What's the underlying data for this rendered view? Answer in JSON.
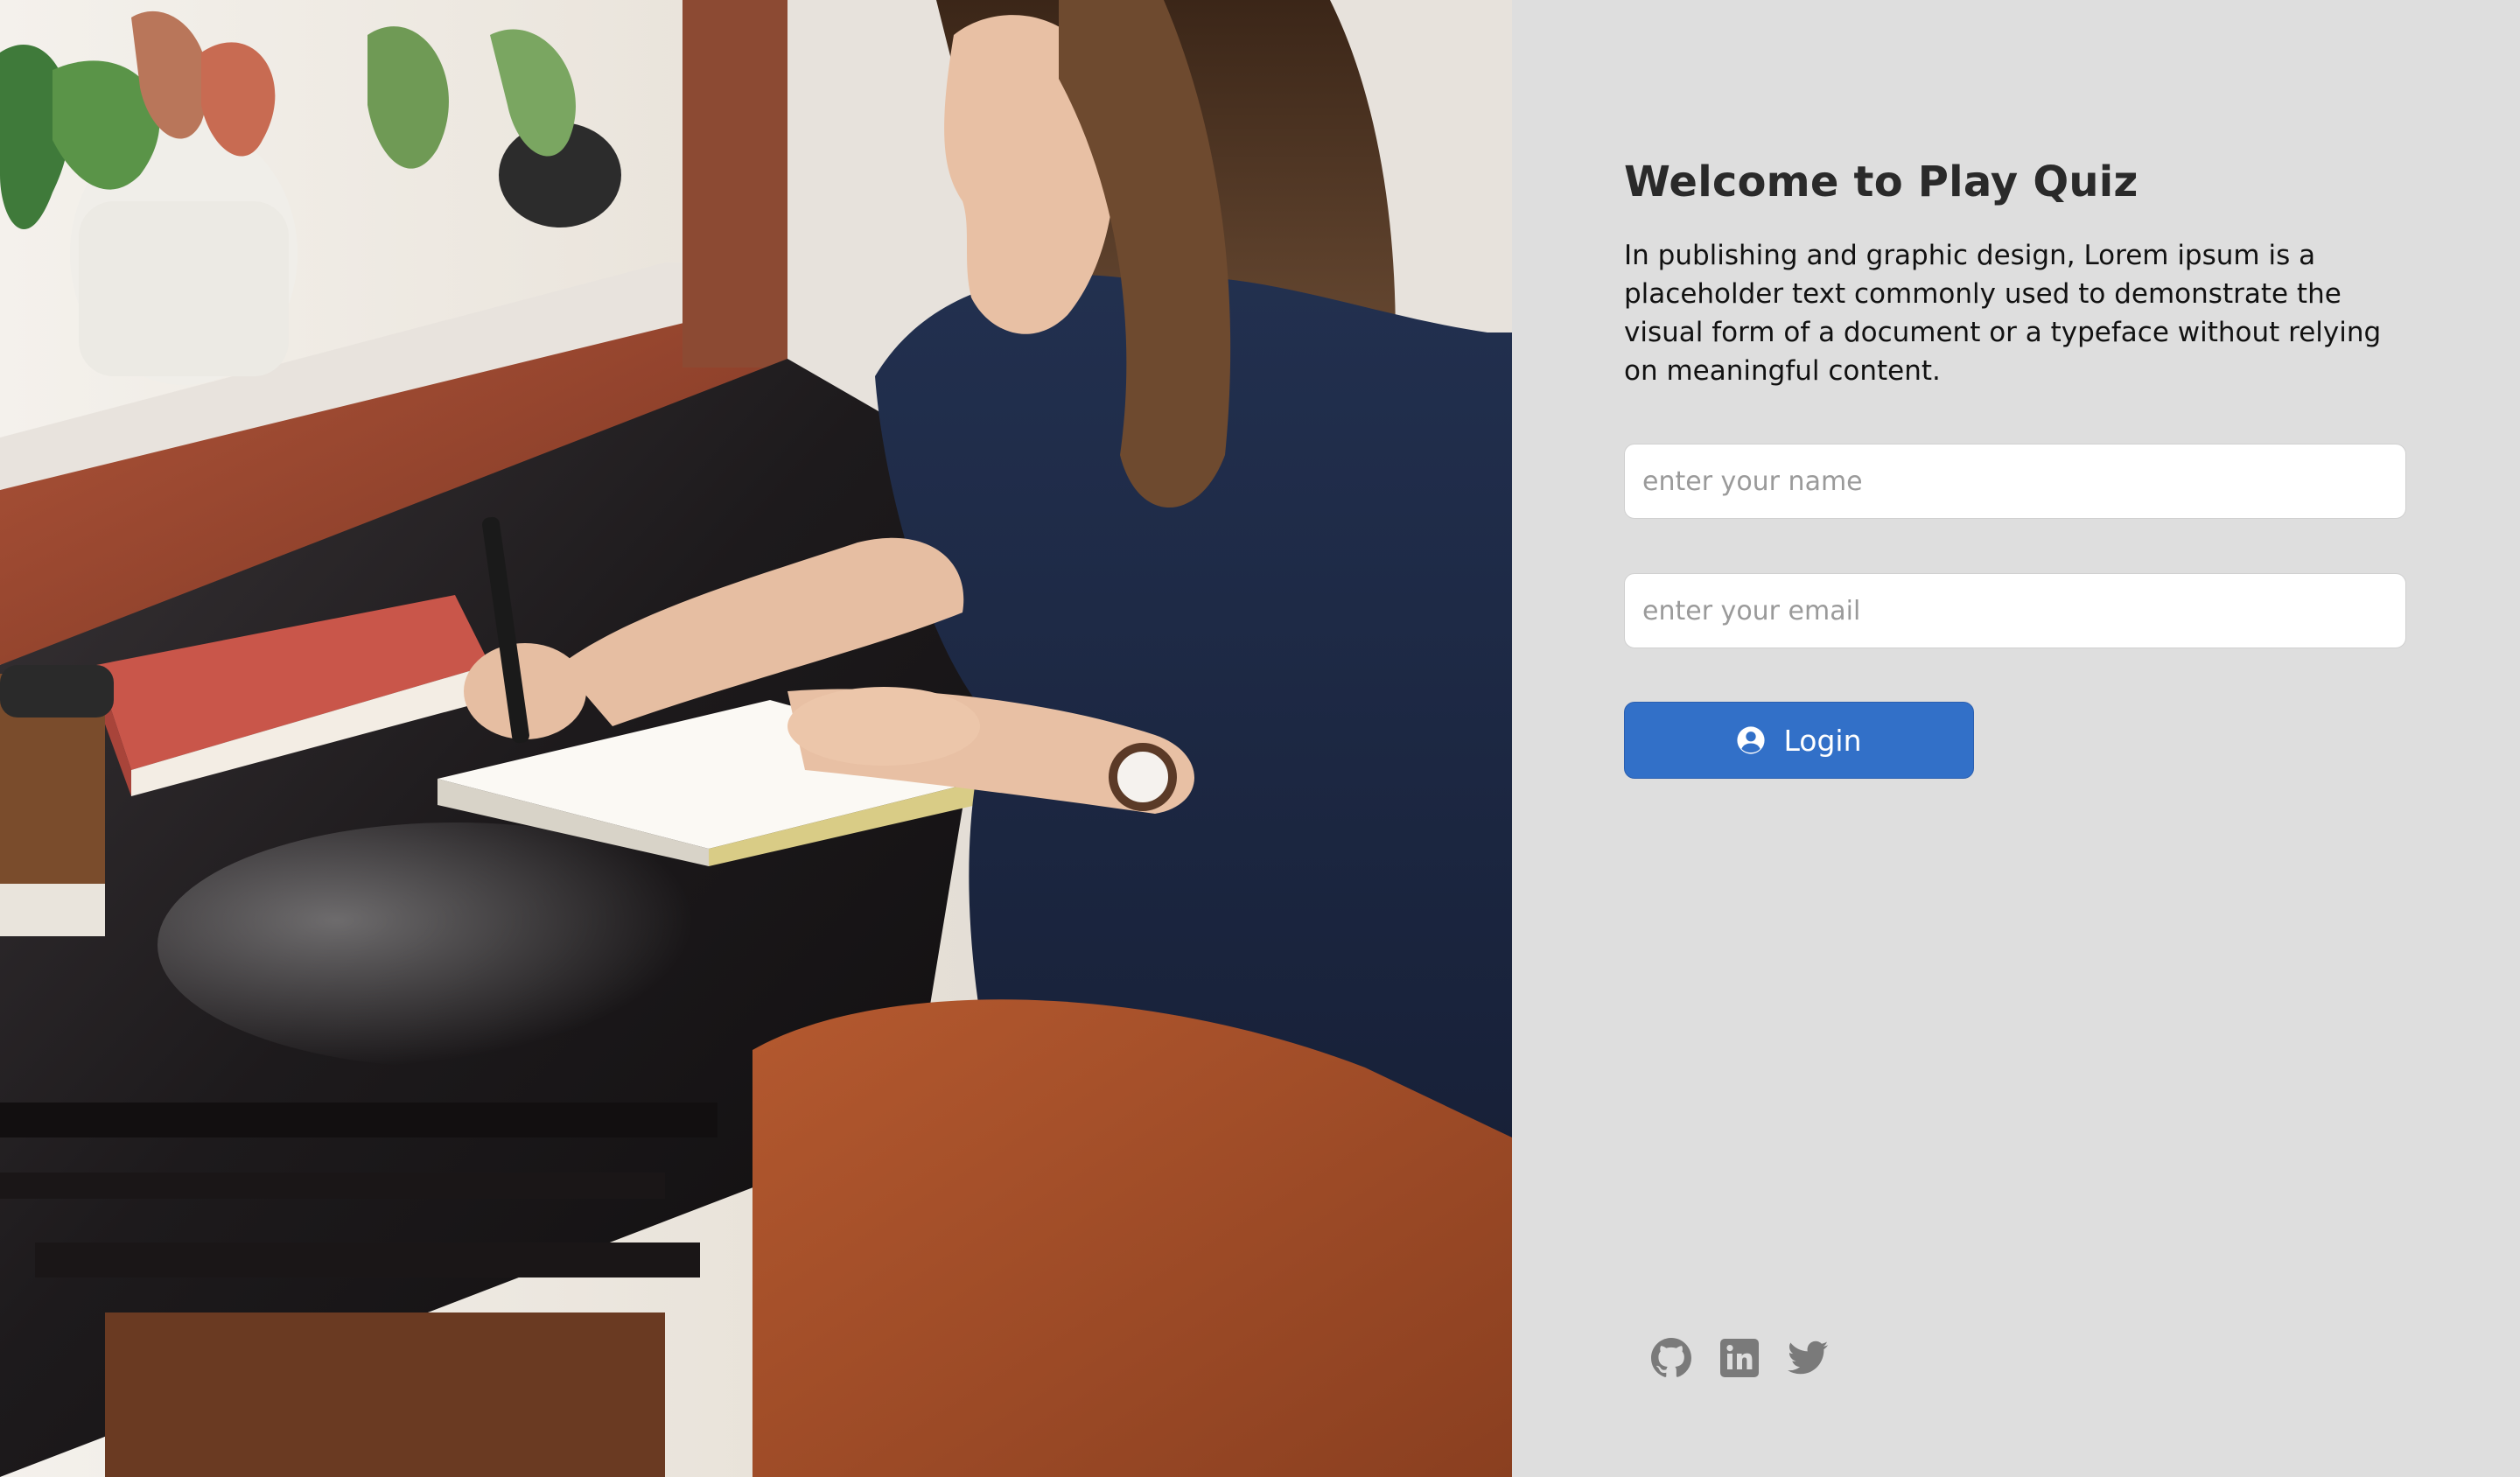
{
  "hero": {
    "image_description": "photo-woman-writing-in-notebook-at-cafe-table"
  },
  "login": {
    "title": "Welcome to Play Quiz",
    "description": "In publishing and graphic design, Lorem ipsum is a placeholder text commonly used to demonstrate the visual form of a document or a typeface without relying on meaningful content.",
    "name_placeholder": "enter your name",
    "email_placeholder": "enter your email",
    "button_label": "Login",
    "button_icon": "user-circle-icon"
  },
  "social": {
    "links": [
      {
        "icon": "github-icon"
      },
      {
        "icon": "linkedin-icon"
      },
      {
        "icon": "twitter-icon"
      }
    ]
  },
  "colors": {
    "panel_bg": "#dedede",
    "button_bg": "#3270c8",
    "title_text": "#2a2a2a",
    "social_icon": "#7a7a7a"
  }
}
